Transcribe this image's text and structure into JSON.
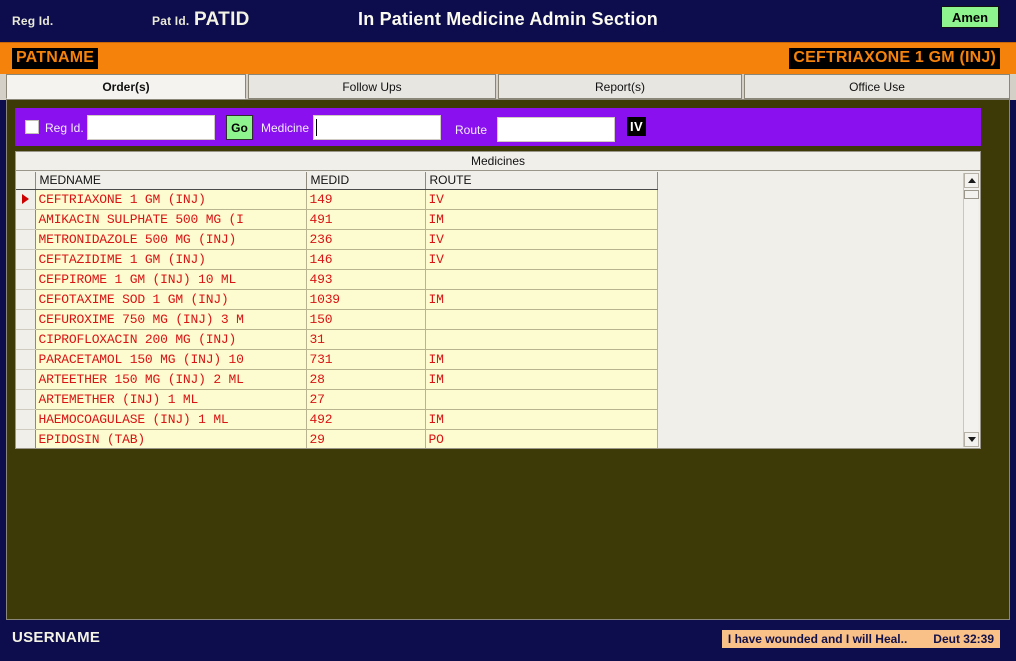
{
  "header": {
    "reg_id_label": "Reg Id.",
    "pat_id_label": "Pat Id.",
    "pat_id_value": "PATID",
    "title": "In Patient Medicine Admin Section",
    "amen_button": "Amen"
  },
  "patient_bar": {
    "patient_name": "PATNAME",
    "current_medicine": "CEFTRIAXONE 1 GM (INJ)",
    "bg_color": "#f5820b",
    "text_color": "#f5820b"
  },
  "tabs": [
    {
      "label": "Order(s)",
      "active": true
    },
    {
      "label": "Follow Ups",
      "active": false
    },
    {
      "label": "Report(s)",
      "active": false
    },
    {
      "label": "Office Use",
      "active": false
    }
  ],
  "toolbar": {
    "bg_color": "#8b10f0",
    "reg_id_label": "Reg Id.",
    "reg_id_value": "",
    "reg_id_placeholder": "",
    "go_label": "Go",
    "medicine_label": "Medicine",
    "medicine_value": "",
    "medicine_placeholder": "",
    "route_label": "Route",
    "route_value": "",
    "route_placeholder": "",
    "route_tag": "IV",
    "checkbox_checked": false
  },
  "grid": {
    "caption": "Medicines",
    "columns": [
      "MEDNAME",
      "MEDID",
      "ROUTE"
    ],
    "selected_row_index": 0,
    "rows": [
      {
        "medname": "CEFTRIAXONE 1 GM (INJ)",
        "medid": "149",
        "route": "IV"
      },
      {
        "medname": "AMIKACIN SULPHATE 500 MG (I",
        "medid": "491",
        "route": "IM"
      },
      {
        "medname": "METRONIDAZOLE 500 MG (INJ)",
        "medid": "236",
        "route": "IV"
      },
      {
        "medname": "CEFTAZIDIME 1 GM (INJ)",
        "medid": "146",
        "route": "IV"
      },
      {
        "medname": "CEFPIROME 1 GM (INJ) 10 ML",
        "medid": "493",
        "route": ""
      },
      {
        "medname": "CEFOTAXIME SOD 1 GM (INJ)",
        "medid": "1039",
        "route": "IM"
      },
      {
        "medname": "CEFUROXIME 750 MG (INJ) 3 M",
        "medid": "150",
        "route": ""
      },
      {
        "medname": "CIPROFLOXACIN 200 MG (INJ)",
        "medid": "31",
        "route": ""
      },
      {
        "medname": "PARACETAMOL 150 MG (INJ) 10",
        "medid": "731",
        "route": "IM"
      },
      {
        "medname": "ARTEETHER 150 MG (INJ) 2 ML",
        "medid": "28",
        "route": "IM"
      },
      {
        "medname": "ARTEMETHER (INJ) 1 ML",
        "medid": "27",
        "route": ""
      },
      {
        "medname": "HAEMOCOAGULASE (INJ) 1 ML",
        "medid": "492",
        "route": "IM"
      },
      {
        "medname": "EPIDOSIN (TAB)",
        "medid": "29",
        "route": "PO"
      }
    ]
  },
  "footer": {
    "username": "USERNAME",
    "verse_text": "I have wounded and I will Heal..",
    "verse_ref": "Deut 32:39"
  }
}
